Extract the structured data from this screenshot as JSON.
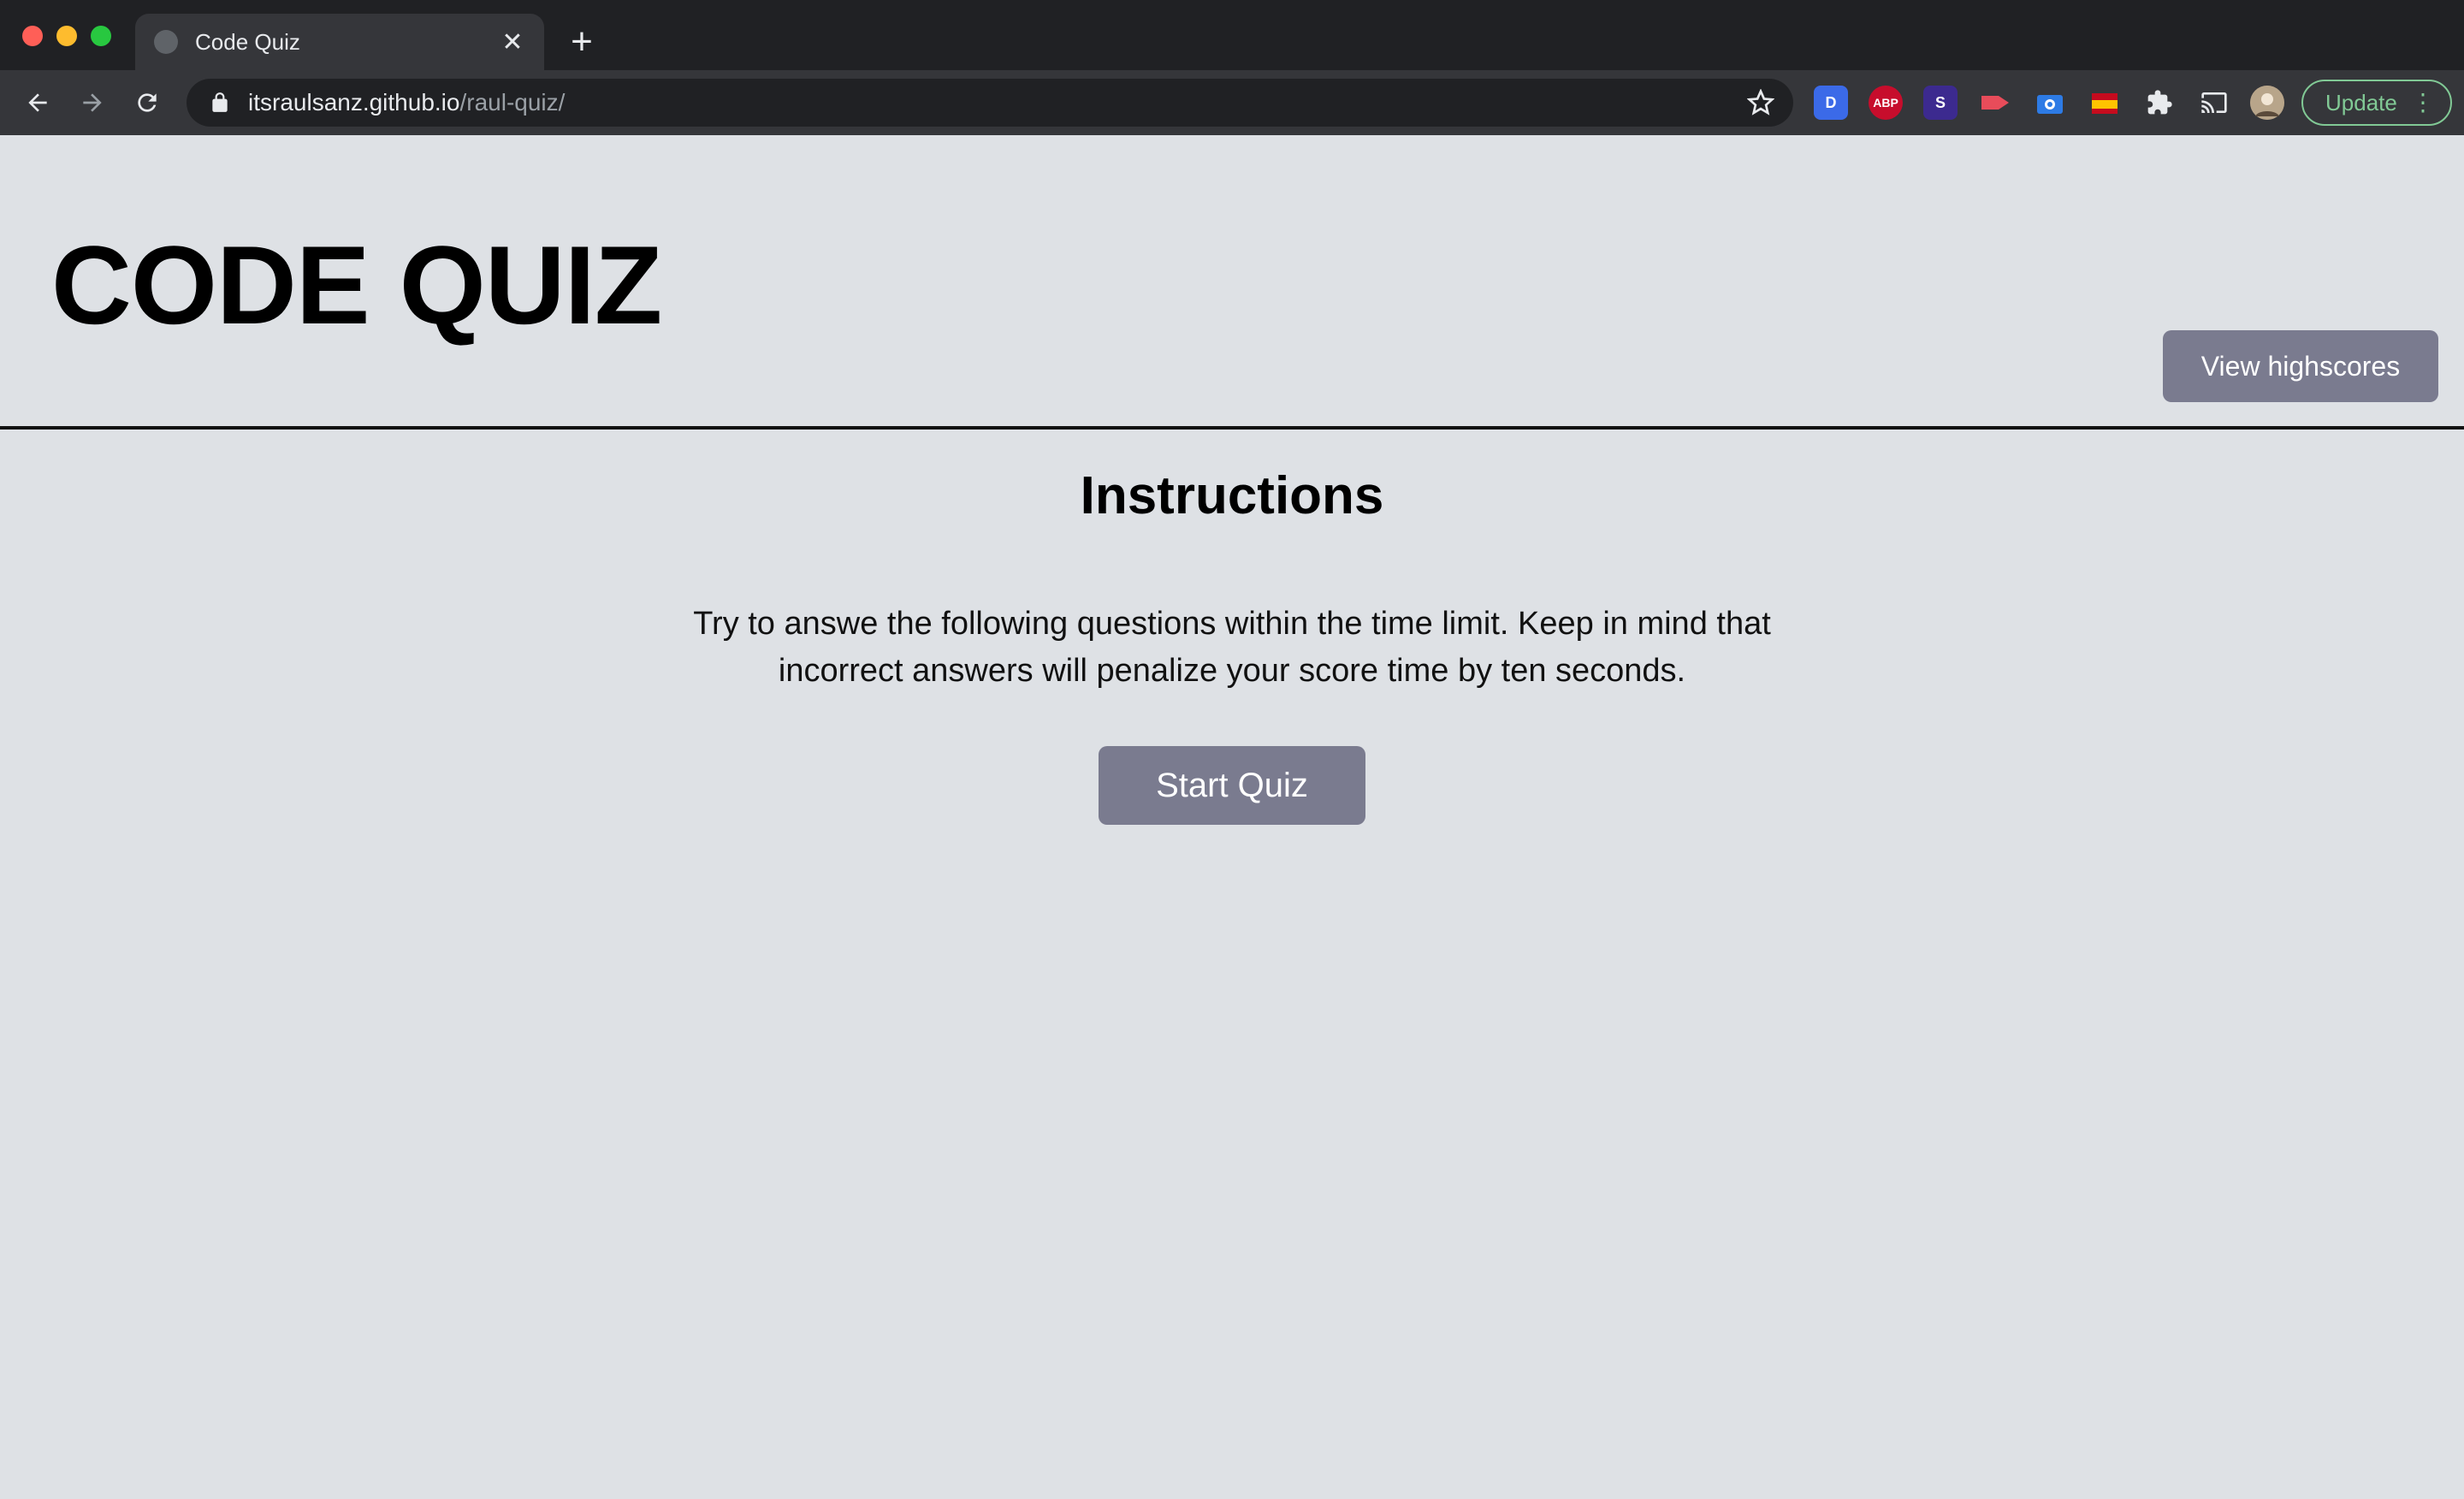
{
  "browser": {
    "tab_title": "Code Quiz",
    "tab_close": "✕",
    "new_tab": "+",
    "url_host": "itsraulsanz.github.io",
    "url_path": "/raul-quiz/",
    "update_label": "Update",
    "extensions": [
      {
        "label": "D",
        "color": "#3b6ae8"
      },
      {
        "label": "ABP",
        "color": "#c70d2c"
      },
      {
        "label": "S",
        "color": "#3c2a8f"
      },
      {
        "label": "",
        "color": "#e84c5a"
      },
      {
        "label": "",
        "color": "#2d7be5"
      },
      {
        "label": "",
        "color": "#e6b422"
      }
    ],
    "icons": [
      "back-icon",
      "forward-icon",
      "reload-icon",
      "lock-icon",
      "star-icon",
      "puzzle-icon",
      "cast-icon",
      "profile-avatar",
      "more-icon"
    ]
  },
  "header": {
    "title": "CODE QUIZ",
    "highscores_label": "View highscores"
  },
  "main": {
    "instructions_title": "Instructions",
    "instructions_text": "Try to answe the following questions within the time limit. Keep in mind that incorrect answers will penalize your score time by ten seconds.",
    "start_label": "Start Quiz"
  },
  "colors": {
    "page_bg": "#dee1e5",
    "button_bg": "#7a7b8f",
    "button_text": "#ffffff"
  }
}
